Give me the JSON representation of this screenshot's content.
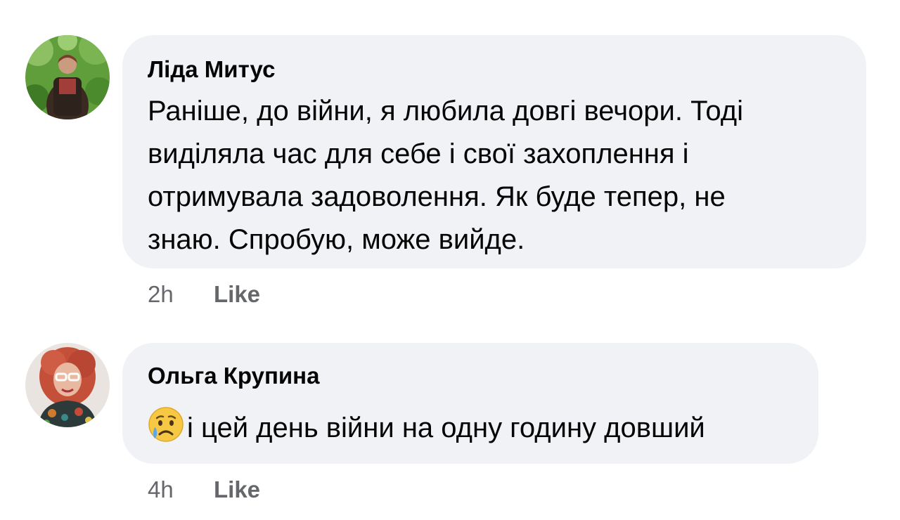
{
  "comments": [
    {
      "author": "Ліда Митус",
      "lines": [
        "Раніше, до війни,  я любила довгі вечори. Тоді",
        "виділяла час для себе і свої захоплення і",
        "отримувала задоволення. Як буде тепер, не",
        "знаю. Спробую, може вийде."
      ],
      "time": "2h",
      "like_label": "Like"
    },
    {
      "author": "Ольга Крупина",
      "emoji": "sad-but-relieved-face-icon",
      "text": "і цей день війни на одну годину довший",
      "time": "4h",
      "like_label": "Like"
    }
  ],
  "colors": {
    "bubble_bg": "#f0f2f5",
    "text": "#050505",
    "meta": "#65676b"
  }
}
